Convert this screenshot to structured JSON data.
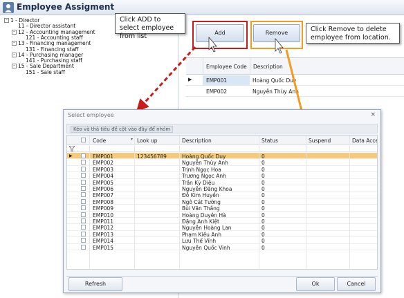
{
  "window": {
    "title": "Employee Assigment"
  },
  "tree": [
    {
      "label": "1 - Director",
      "level": 0,
      "toggle": "-"
    },
    {
      "label": "11 - Director assistant",
      "level": 1,
      "toggle": ""
    },
    {
      "label": "12 - Accounting management",
      "level": 1,
      "toggle": "-"
    },
    {
      "label": "121 - Accounting staff",
      "level": 2,
      "toggle": ""
    },
    {
      "label": "13 - Financing management",
      "level": 1,
      "toggle": "-"
    },
    {
      "label": "131 - Financing staff",
      "level": 2,
      "toggle": ""
    },
    {
      "label": "14 - Purchasing manager",
      "level": 1,
      "toggle": "-"
    },
    {
      "label": "141 - Purchasing staff",
      "level": 2,
      "toggle": ""
    },
    {
      "label": "15 - Sale Department",
      "level": 1,
      "toggle": "-"
    },
    {
      "label": "151 - Sale staff",
      "level": 2,
      "toggle": ""
    }
  ],
  "toolbar": {
    "add_label": "Add",
    "remove_label": "Remove"
  },
  "callouts": {
    "add": "Click ADD  to select employee from list",
    "remove": "Click Remove to delete employee from location."
  },
  "assigned_grid": {
    "headers": [
      "Employee Code",
      "Description"
    ],
    "rows": [
      {
        "code": "EMP001",
        "description": "Hoàng  Quốc Duy"
      },
      {
        "code": "EMP002",
        "description": "Nguyễn  Thùy Anh"
      }
    ]
  },
  "dialog": {
    "title": "Select employee",
    "close": "×",
    "group_hint": "Kéo và thả tiêu đề cột vào đây để nhóm",
    "headers": [
      "Code",
      "Look up",
      "Description",
      "Status",
      "Suspend",
      "Data Acces"
    ],
    "rows": [
      {
        "code": "EMP001",
        "lookup": "123456789",
        "description": "Hoàng  Quốc Duy",
        "status": "0"
      },
      {
        "code": "EMP002",
        "lookup": "",
        "description": "Nguyễn  Thùy Anh",
        "status": "0"
      },
      {
        "code": "EMP003",
        "lookup": "",
        "description": "Trịnh  Ngọc Hoa",
        "status": "0"
      },
      {
        "code": "EMP004",
        "lookup": "",
        "description": "Trương  Ngọc Anh",
        "status": "0"
      },
      {
        "code": "EMP005",
        "lookup": "",
        "description": "Trần  Kỳ Diệu",
        "status": "0"
      },
      {
        "code": "EMP006",
        "lookup": "",
        "description": "Nguyễn  Đăng Khoa",
        "status": "0"
      },
      {
        "code": "EMP007",
        "lookup": "",
        "description": "Đỗ  Kim Huyền",
        "status": "0"
      },
      {
        "code": "EMP008",
        "lookup": "",
        "description": "Ngô  Cát Tường",
        "status": "0"
      },
      {
        "code": "EMP009",
        "lookup": "",
        "description": "Bùi  Văn Thắng",
        "status": "0"
      },
      {
        "code": "EMP010",
        "lookup": "",
        "description": "Hoàng  Duyên Hà",
        "status": "0"
      },
      {
        "code": "EMP011",
        "lookup": "",
        "description": "Đặng  Anh Kiệt",
        "status": "0"
      },
      {
        "code": "EMP012",
        "lookup": "",
        "description": "Nguyễn  Hoàng Lan",
        "status": "0"
      },
      {
        "code": "EMP013",
        "lookup": "",
        "description": "Phạm  Kiều Anh",
        "status": "0"
      },
      {
        "code": "EMP014",
        "lookup": "",
        "description": "Lưu  Thế Vĩnh",
        "status": "0"
      },
      {
        "code": "EMP015",
        "lookup": "",
        "description": "Nguyễn  Quốc Vinh",
        "status": "0"
      }
    ],
    "refresh_label": "Refresh",
    "ok_label": "Ok",
    "cancel_label": "Cancel"
  },
  "colors": {
    "selected_row": "#f8c978",
    "callout_add_border": "#c91c1c",
    "callout_remove_border": "#f39a21",
    "arrow_red": "#c91c1c",
    "arrow_orange": "#f39a21"
  }
}
